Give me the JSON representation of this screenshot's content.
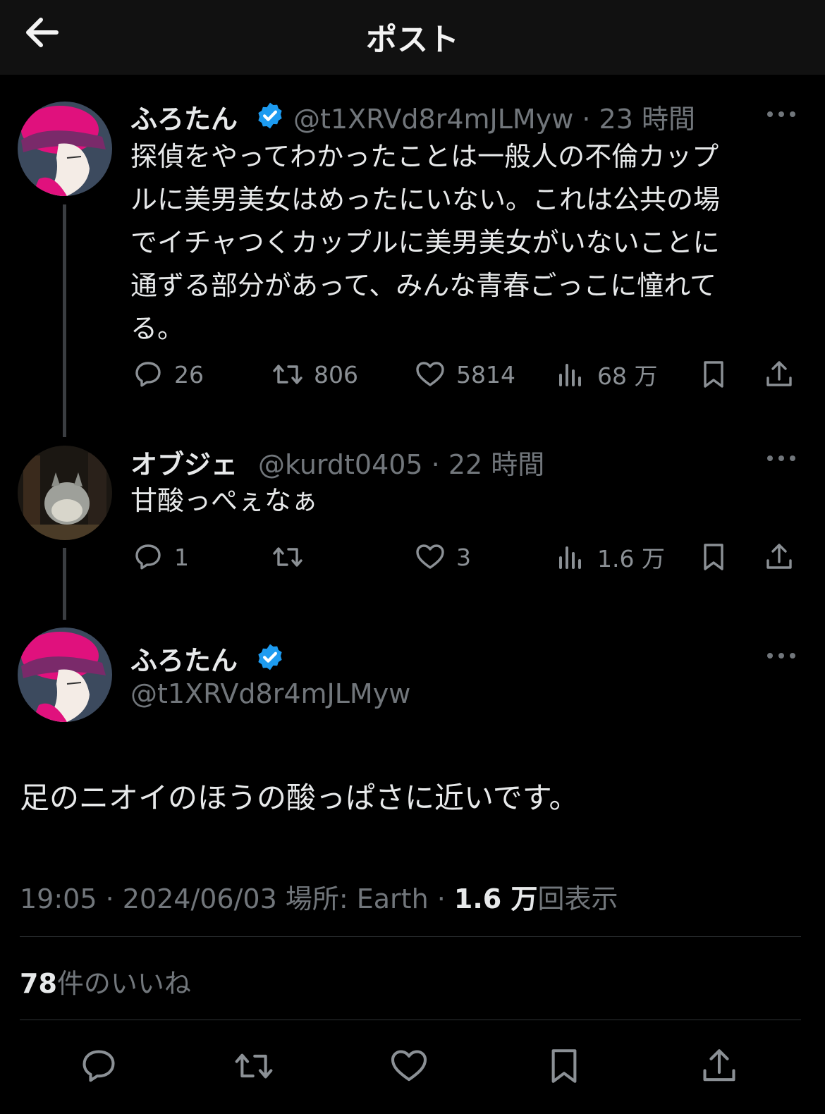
{
  "header": {
    "title": "ポスト"
  },
  "colors": {
    "verified": "#1d9bf0",
    "muted": "#71767b",
    "accent_pink": "#e0117d"
  },
  "post1": {
    "name": "ふろたん",
    "meta": "@t1XRVd8r4mJLMyw · 23 時間",
    "lines": [
      "探偵をやってわかったことは一般人の不倫カップ",
      "ルに美男美女はめったにいない。これは公共の場",
      "でイチャつくカップルに美男美女がいないことに",
      "通ずる部分があって、みんな青春ごっこに憧れて",
      "る。"
    ],
    "replies": "26",
    "reposts": "806",
    "likes": "5814",
    "views": "68 万"
  },
  "post2": {
    "name": "オブジェ",
    "meta": "@kurdt0405 · 22 時間",
    "text": "甘酸っぺぇなぁ",
    "replies": "1",
    "likes": "3",
    "views": "1.6 万"
  },
  "main_post": {
    "name": "ふろたん",
    "handle": "@t1XRVd8r4mJLMyw",
    "text": "足のニオイのほうの酸っぱさに近いです。",
    "time": "19:05 · 2024/06/03",
    "location": "場所: Earth ·",
    "view_count": "1.6 万",
    "view_suffix": "回表示",
    "like_count": "78",
    "like_suffix": "件のいいね"
  }
}
